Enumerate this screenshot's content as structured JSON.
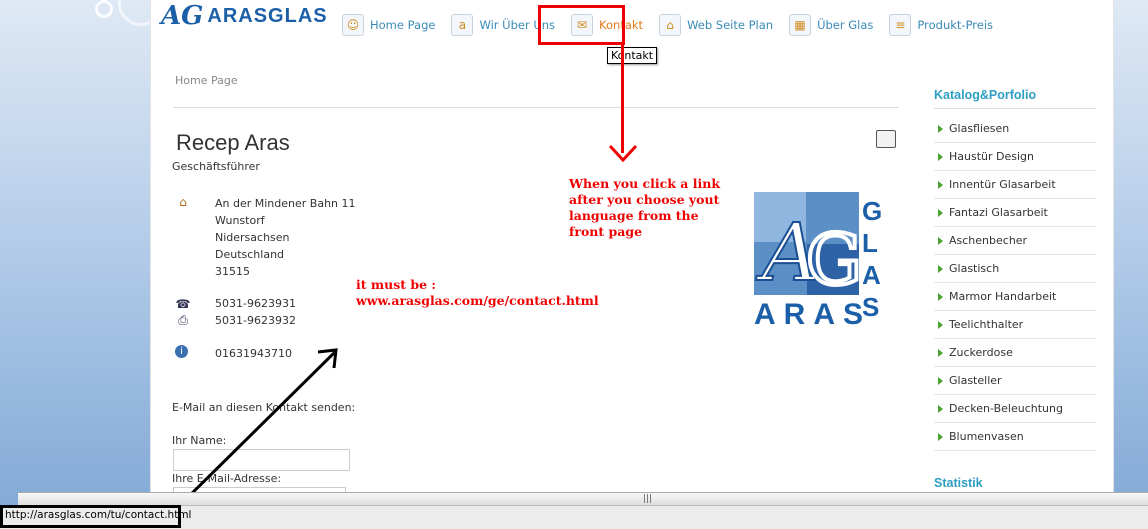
{
  "logo": {
    "mark": "AG",
    "text": "ARASGLAS"
  },
  "nav": [
    {
      "label": "Home Page",
      "icon": "home-icon",
      "glyph": "☺"
    },
    {
      "label": "Wir Über Uns",
      "icon": "about-icon",
      "glyph": "a"
    },
    {
      "label": "Kontakt",
      "icon": "contact-icon",
      "glyph": "✉",
      "active": true
    },
    {
      "label": "Web Seite Plan",
      "icon": "sitemap-icon",
      "glyph": "⌂"
    },
    {
      "label": "Über Glas",
      "icon": "glass-icon",
      "glyph": "▦"
    },
    {
      "label": "Produkt-Preis",
      "icon": "price-icon",
      "glyph": "≡"
    }
  ],
  "tooltip": "Kontakt",
  "breadcrumb": "Home Page",
  "contact": {
    "name": "Recep Aras",
    "role": "Geschäftsführer",
    "address": [
      "An der Mindener Bahn 11",
      "Wunstorf",
      "Nidersachsen",
      "Deutschland",
      "31515"
    ],
    "phone": "5031-9623931",
    "fax": "5031-9623932",
    "mobile": "01631943710"
  },
  "form": {
    "email_label": "E-Mail an diesen Kontakt senden:",
    "name_label": "Ihr Name:",
    "email2_label": "Ihre E-Mail-Adresse:"
  },
  "sidebar": {
    "title": "Katalog&Porfolio",
    "items": [
      "Glasfliesen",
      "Haustür Design",
      "Innentür Glasarbeit",
      "Fantazi Glasarbeit",
      "Aschenbecher",
      "Glastisch",
      "Marmor Handarbeit",
      "Teelichthalter",
      "Zuckerdose",
      "Glasteller",
      "Decken-Beleuchtung",
      "Blumenvasen"
    ],
    "stat_title": "Statistik"
  },
  "ag_logo": {
    "letters_side": [
      "G",
      "L",
      "A",
      "S"
    ],
    "bottom": "ARAS"
  },
  "annotations": {
    "note1": [
      "When you click a link",
      "after you choose yout",
      "language from the",
      "front page"
    ],
    "note2": [
      "it must be :",
      "www.arasglas.com/ge/contact.html"
    ]
  },
  "status_url": "http://arasglas.com/tu/contact.html",
  "colors": {
    "accent": "#2e9fc4",
    "annotation_red": "#e00000",
    "brand_blue": "#1b5fa8"
  }
}
